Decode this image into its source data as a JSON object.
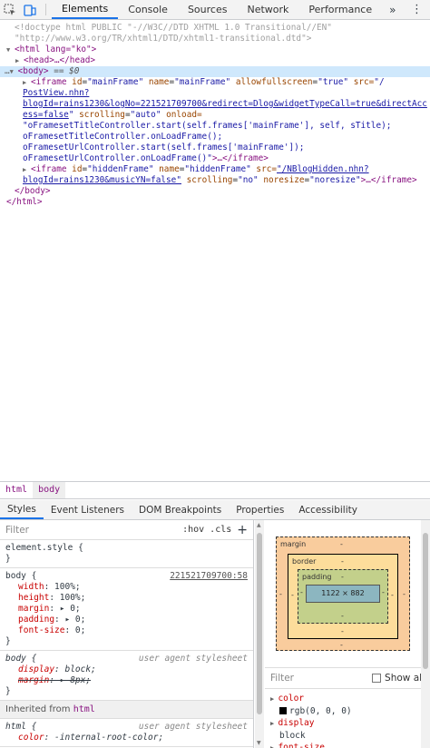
{
  "toolbar": {
    "inspect_icon": "inspect-cursor-icon",
    "device_icon": "device-toggle-icon",
    "tabs": [
      "Elements",
      "Console",
      "Sources",
      "Network",
      "Performance"
    ],
    "more": "»",
    "menu": "⋮",
    "accent": "#1a73e8"
  },
  "tree": {
    "doctype1": "<!doctype html PUBLIC \"-//W3C//DTD XHTML 1.0 Transitional//EN\"",
    "doctype2": "\"http://www.w3.org/TR/xhtml1/DTD/xhtml1-transitional.dtd\">",
    "html_open": "<html lang=\"ko\">",
    "head": "<head>…</head>",
    "body_open": "<body>",
    "body_marker": "== $0",
    "iframe1": {
      "tag": "<iframe",
      "id_attr": "id",
      "id_val": "\"mainFrame\"",
      "name_attr": "name",
      "name_val": "\"mainFrame\"",
      "allow_attr": "allowfullscreen",
      "allow_val": "\"true\"",
      "src_attr": "src=",
      "src1": "\"/",
      "src2": "PostView.nhn?",
      "src3": "blogId=rains1230&logNo=221521709700&redirect=Dlog&widgetTypeCall=true&directAcc",
      "src4": "ess=false",
      "scroll_attr": "scrolling",
      "scroll_val": "\"auto\"",
      "onload_attr": "onload=",
      "onload1": "\"oFramesetTitleController.start(self.frames['mainFrame'], self, sTitle);",
      "onload2": "oFramesetTitleController.onLoadFrame();",
      "onload3": "oFramesetUrlController.start(self.frames['mainFrame']);",
      "onload4": "oFramesetUrlController.onLoadFrame()\"",
      "close": ">…</iframe>"
    },
    "iframe2": {
      "tag": "<iframe",
      "id_attr": "id",
      "id_val": "\"hiddenFrame\"",
      "name_attr": "name",
      "name_val": "\"hiddenFrame\"",
      "src_attr": "src=",
      "src1": "\"/NBlogHidden.nhn?",
      "src2": "blogId=rains1230&musicYN=false\"",
      "scroll_attr": "scrolling",
      "scroll_val": "\"no\"",
      "noresize_attr": "noresize",
      "noresize_val": "\"noresize\"",
      "close": ">…</iframe>"
    },
    "body_close": "</body>",
    "html_close": "</html>"
  },
  "breadcrumbs": [
    "html",
    "body"
  ],
  "subtabs": [
    "Styles",
    "Event Listeners",
    "DOM Breakpoints",
    "Properties",
    "Accessibility"
  ],
  "styles": {
    "filter_placeholder": "Filter",
    "hov": ":hov",
    "cls": ".cls",
    "plus": "+",
    "element_style": "element.style {",
    "element_style_close": "}",
    "body_rule": {
      "selector": "body {",
      "source": "221521709700:58",
      "props": [
        {
          "name": "width",
          "value": ": 100%;"
        },
        {
          "name": "height",
          "value": ": 100%;"
        },
        {
          "name": "margin",
          "value": ": ▸ 0;"
        },
        {
          "name": "padding",
          "value": ": ▸ 0;"
        },
        {
          "name": "font-size",
          "value": ": 0;"
        }
      ],
      "close": "}"
    },
    "ua_rule": {
      "selector": "body {",
      "source": "user agent stylesheet",
      "props": [
        {
          "name": "display",
          "value": ": block;"
        },
        {
          "name": "margin",
          "value": ": ▸ 8px;"
        }
      ],
      "close": "}"
    },
    "inherited_label": "Inherited from",
    "inherited_tag": "html",
    "html_rule": {
      "selector": "html {",
      "source": "user agent stylesheet",
      "prop_name": "color",
      "prop_value": ": -internal-root-color;"
    }
  },
  "boxmodel": {
    "margin_label": "margin",
    "margin_top": "-",
    "margin_bottom": "-",
    "margin_left": "-",
    "margin_right": "-",
    "border_label": "border",
    "border_top": "-",
    "border_bottom": "-",
    "border_left": "-",
    "border_right": "-",
    "padding_label": "padding",
    "padding_top": "-",
    "padding_bottom": "-",
    "padding_left": "-",
    "padding_right": "-",
    "content": "1122 × 882"
  },
  "computed": {
    "filter_placeholder": "Filter",
    "show_all": "Show all",
    "items": [
      {
        "name": "color",
        "value": "rgb(0, 0, 0)"
      },
      {
        "name": "display",
        "value": "block"
      },
      {
        "name": "font-size",
        "value": ""
      }
    ]
  }
}
